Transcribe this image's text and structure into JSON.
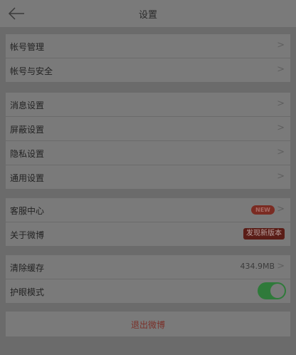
{
  "header": {
    "title": "设置",
    "back_icon": "back-arrow-icon"
  },
  "group1": {
    "items": [
      {
        "label": "帐号管理",
        "chevron": ">"
      },
      {
        "label": "帐号与安全",
        "chevron": ">"
      }
    ]
  },
  "group2": {
    "items": [
      {
        "label": "消息设置",
        "chevron": ">"
      },
      {
        "label": "屏蔽设置",
        "chevron": ">"
      },
      {
        "label": "隐私设置",
        "chevron": ">"
      },
      {
        "label": "通用设置",
        "chevron": ">"
      }
    ]
  },
  "group3": {
    "items": [
      {
        "label": "客服中心",
        "badge": "NEW",
        "chevron": ">"
      },
      {
        "label": "关于微博",
        "badge": "发现新版本"
      }
    ]
  },
  "group4": {
    "items": [
      {
        "label": "清除缓存",
        "value": "434.9MB",
        "chevron": ">"
      },
      {
        "label": "护眼模式",
        "toggle_on": true
      }
    ]
  },
  "logout": {
    "label": "退出微博"
  },
  "colors": {
    "accent_red": "#7a3029",
    "toggle_green": "#2f7a3a"
  }
}
